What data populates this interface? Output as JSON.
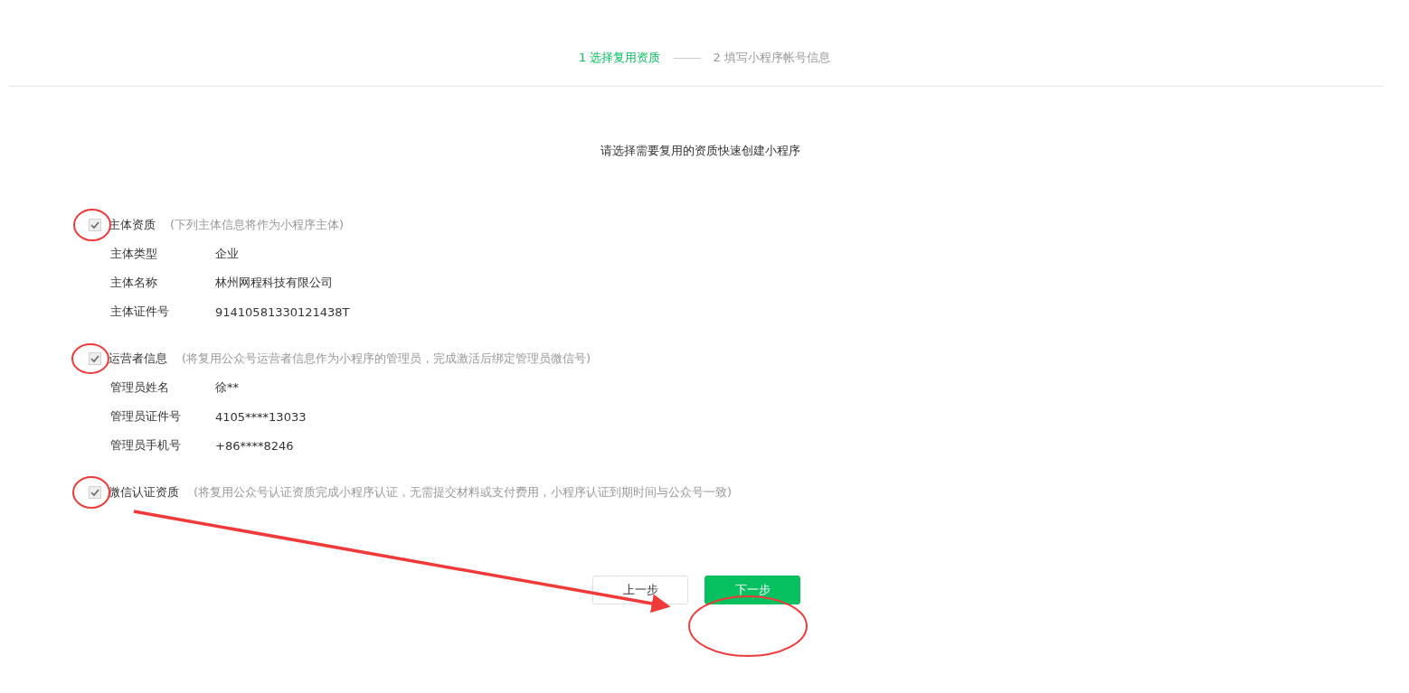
{
  "steps": [
    {
      "label": "1 选择复用资质",
      "selected": true
    },
    {
      "label": "2 填写小程序帐号信息",
      "selected": false
    }
  ],
  "heading": "请选择需要复用的资质快速创建小程序",
  "sections": [
    {
      "title": "主体资质",
      "hint": "(下列主体信息将作为小程序主体)",
      "checked": true,
      "fields": [
        {
          "label": "主体类型",
          "value": "企业"
        },
        {
          "label": "主体名称",
          "value": "林州网程科技有限公司"
        },
        {
          "label": "主体证件号",
          "value": "91410581330121438T"
        }
      ]
    },
    {
      "title": "运营者信息",
      "hint": "(将复用公众号运营者信息作为小程序的管理员，完成激活后绑定管理员微信号)",
      "checked": true,
      "fields": [
        {
          "label": "管理员姓名",
          "value": "徐**"
        },
        {
          "label": "管理员证件号",
          "value": "4105****13033"
        },
        {
          "label": "管理员手机号",
          "value": "+86****8246"
        }
      ]
    },
    {
      "title": "微信认证资质",
      "hint": "(将复用公众号认证资质完成小程序认证，无需提交材料或支付费用，小程序认证到期时间与公众号一致)",
      "checked": true
    }
  ],
  "buttons": [
    {
      "label": "上一步",
      "kind": "secondary"
    },
    {
      "label": "下一步",
      "kind": "primary"
    }
  ]
}
